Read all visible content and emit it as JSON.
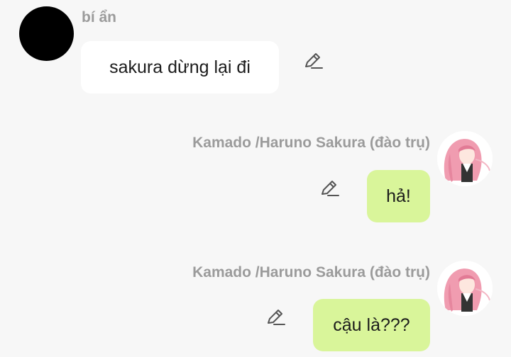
{
  "messages": [
    {
      "sender": "bí ẩn",
      "text": "sakura dừng lại đi",
      "side": "left",
      "avatar": "black-circle-avatar",
      "action_icon": "pencil-icon"
    },
    {
      "sender": "Kamado /Haruno Sakura (đào trụ)",
      "text": "hả!",
      "side": "right",
      "avatar": "pink-hair-character-avatar",
      "action_icon": "pencil-icon"
    },
    {
      "sender": "Kamado /Haruno Sakura (đào trụ)",
      "text": "cậu là???",
      "side": "right",
      "avatar": "pink-hair-character-avatar",
      "action_icon": "pencil-icon"
    }
  ],
  "colors": {
    "background": "#f7f7f7",
    "incoming_bubble": "#ffffff",
    "outgoing_bubble": "#d9f59a",
    "sender_name": "#9b9b9b",
    "message_text": "#1b1b1b",
    "icon": "#555555"
  }
}
